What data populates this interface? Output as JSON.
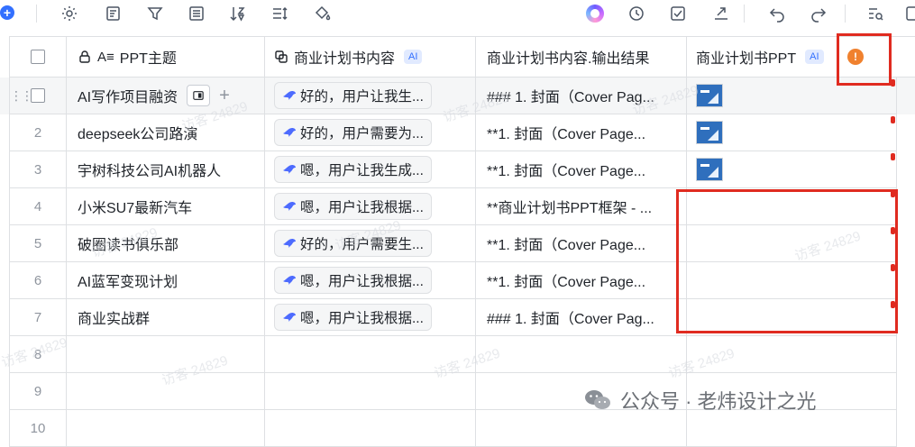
{
  "toolbar": {
    "left_icons": [
      "add-icon",
      "settings-icon",
      "form-icon",
      "filter-icon",
      "list-icon",
      "sort-icon",
      "row-height-icon",
      "fill-color-icon"
    ],
    "right_icons": [
      "ai-assistant-icon",
      "history-icon",
      "checkbox-icon",
      "share-icon",
      "undo-icon",
      "redo-icon",
      "search-icon"
    ]
  },
  "columns": {
    "title": "PPT主题",
    "content": "商业计划书内容",
    "content_ai": "AI",
    "output": "商业计划书内容.输出结果",
    "ppt": "商业计划书PPT",
    "ppt_ai": "AI",
    "warn_symbol": "!"
  },
  "rows": [
    {
      "num": "1",
      "title": "AI写作项目融资",
      "content": "好的，用户让我生...",
      "output": "### 1. 封面（Cover Pag...",
      "has_ppt": true
    },
    {
      "num": "2",
      "title": "deepseek公司路演",
      "content": "好的，用户需要为...",
      "output": "**1. 封面（Cover Page...",
      "has_ppt": true
    },
    {
      "num": "3",
      "title": "宇树科技公司AI机器人",
      "content": "嗯，用户让我生成...",
      "output": "**1. 封面（Cover Page...",
      "has_ppt": true
    },
    {
      "num": "4",
      "title": "小米SU7最新汽车",
      "content": "嗯，用户让我根据...",
      "output": "**商业计划书PPT框架 - ...",
      "has_ppt": false
    },
    {
      "num": "5",
      "title": "破圈读书俱乐部",
      "content": "好的，用户需要生...",
      "output": "**1. 封面（Cover Page...",
      "has_ppt": false
    },
    {
      "num": "6",
      "title": "AI蓝军变现计划",
      "content": "嗯，用户让我根据...",
      "output": "**1. 封面（Cover Page...",
      "has_ppt": false
    },
    {
      "num": "7",
      "title": "商业实战群",
      "content": "嗯，用户让我根据...",
      "output": "### 1. 封面（Cover Pag...",
      "has_ppt": false
    }
  ],
  "empty_rows": [
    "8",
    "9",
    "10"
  ],
  "watermark_text": "访客 24829",
  "footer_watermark": "公众号 · 老炜设计之光",
  "colors": {
    "accent": "#3370ff",
    "highlight": "#e02b20",
    "warning": "#f0812e"
  }
}
